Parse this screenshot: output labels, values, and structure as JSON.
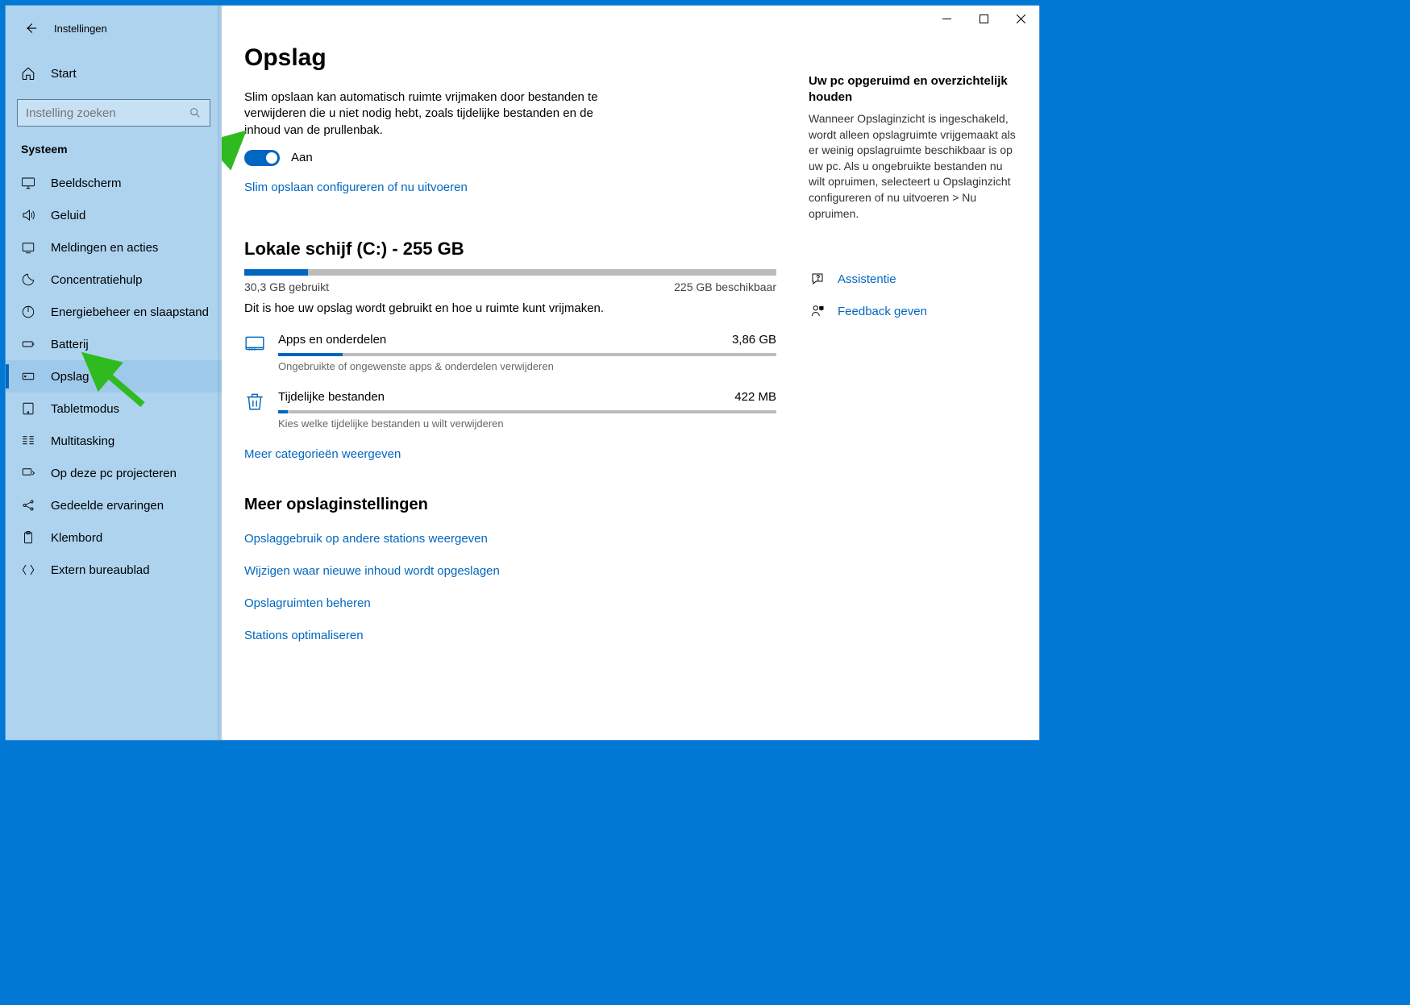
{
  "app_title": "Instellingen",
  "home_label": "Start",
  "search_placeholder": "Instelling zoeken",
  "group_label": "Systeem",
  "nav": [
    {
      "id": "display",
      "label": "Beeldscherm"
    },
    {
      "id": "sound",
      "label": "Geluid"
    },
    {
      "id": "notifications",
      "label": "Meldingen en acties"
    },
    {
      "id": "focus",
      "label": "Concentratiehulp"
    },
    {
      "id": "power",
      "label": "Energiebeheer en slaapstand"
    },
    {
      "id": "battery",
      "label": "Batterij"
    },
    {
      "id": "storage",
      "label": "Opslag",
      "selected": true
    },
    {
      "id": "tablet",
      "label": "Tabletmodus"
    },
    {
      "id": "multitask",
      "label": "Multitasking"
    },
    {
      "id": "project",
      "label": "Op deze pc projecteren"
    },
    {
      "id": "shared",
      "label": "Gedeelde ervaringen"
    },
    {
      "id": "clipboard",
      "label": "Klembord"
    },
    {
      "id": "remote",
      "label": "Extern bureaublad"
    }
  ],
  "page": {
    "title": "Opslag",
    "description": "Slim opslaan kan automatisch ruimte vrijmaken door bestanden te verwijderen die u niet nodig hebt, zoals tijdelijke bestanden en de inhoud van de prullenbak.",
    "toggle_state_label": "Aan",
    "configure_link": "Slim opslaan configureren of nu uitvoeren",
    "disk": {
      "heading": "Lokale schijf (C:) - 255 GB",
      "used_label": "30,3 GB gebruikt",
      "free_label": "225 GB beschikbaar",
      "used_pct": 12,
      "usage_desc": "Dit is hoe uw opslag wordt gebruikt en hoe u ruimte kunt vrijmaken."
    },
    "categories": [
      {
        "name": "Apps en onderdelen",
        "size": "3,86 GB",
        "sub": "Ongebruikte of ongewenste apps & onderdelen verwijderen",
        "pct": 13,
        "icon": "apps"
      },
      {
        "name": "Tijdelijke bestanden",
        "size": "422 MB",
        "sub": "Kies welke tijdelijke bestanden u wilt verwijderen",
        "pct": 2,
        "icon": "trash"
      }
    ],
    "more_categories_link": "Meer categorieën weergeven",
    "more_settings_heading": "Meer opslaginstellingen",
    "more_links": [
      "Opslaggebruik op andere stations weergeven",
      "Wijzigen waar nieuwe inhoud wordt opgeslagen",
      "Opslagruimten beheren",
      "Stations optimaliseren"
    ]
  },
  "right": {
    "heading": "Uw pc opgeruimd en overzichtelijk houden",
    "text": "Wanneer Opslaginzicht is ingeschakeld, wordt alleen opslagruimte vrijgemaakt als er weinig opslagruimte beschikbaar is op uw pc. Als u ongebruikte bestanden nu wilt opruimen, selecteert u Opslaginzicht configureren of nu uitvoeren > Nu opruimen.",
    "help_label": "Assistentie",
    "feedback_label": "Feedback geven"
  }
}
